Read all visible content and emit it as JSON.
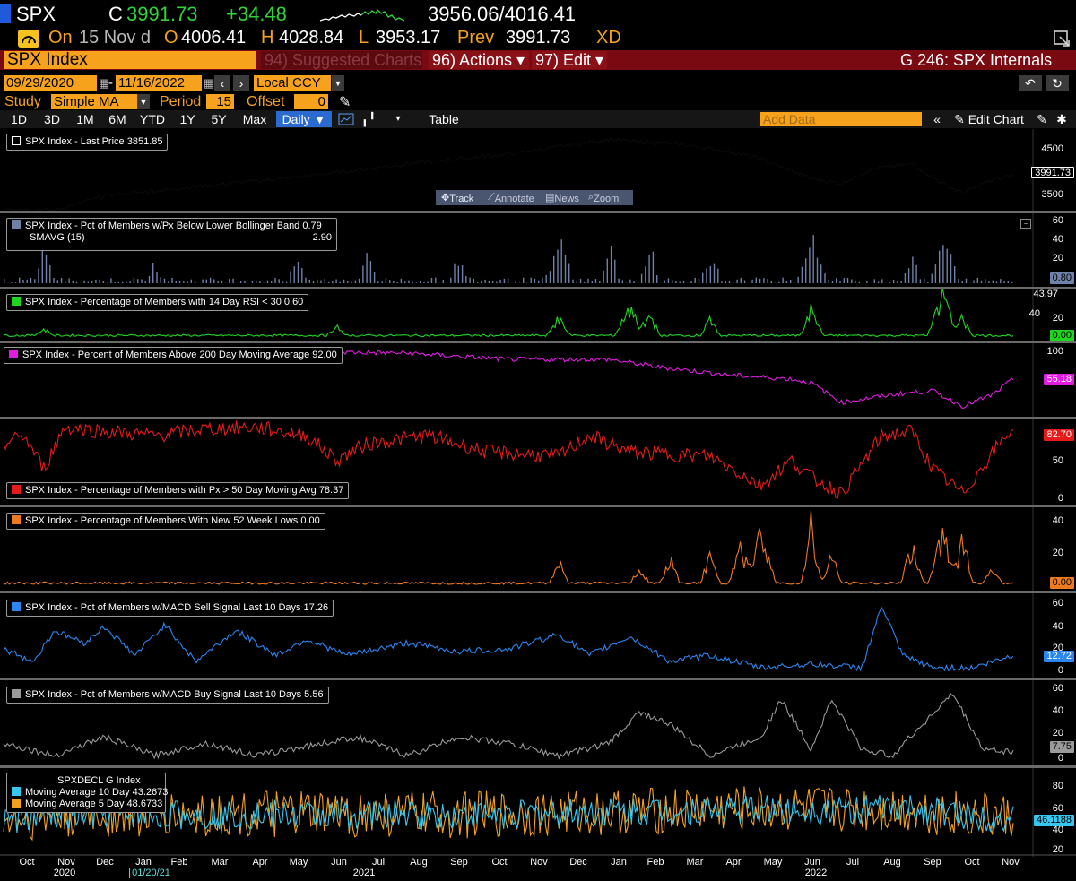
{
  "quote": {
    "ticker": "SPX",
    "c_label": "C",
    "last": "3991.73",
    "change": "+34.48",
    "range": "3956.06/4016.41",
    "on_label": "On",
    "date": "15 Nov d",
    "o_label": "O",
    "open": "4006.41",
    "h_label": "H",
    "high": "4028.84",
    "l_label": "L",
    "low": "3953.17",
    "prev_label": "Prev",
    "prev": "3991.73",
    "xd": "XD"
  },
  "titlebar": {
    "security": "SPX Index",
    "suggested": "94) Suggested Charts",
    "actions": "96) Actions ▾",
    "edit": "97) Edit ▾",
    "chart_title": "G 246: SPX Internals"
  },
  "controls": {
    "start_date": "09/29/2020",
    "end_date": "11/16/2022",
    "currency": "Local CCY",
    "study_label": "Study",
    "study_value": "Simple MA",
    "period_label": "Period",
    "period_value": "15",
    "offset_label": "Offset",
    "offset_value": "0"
  },
  "rangebar": {
    "buttons": [
      "1D",
      "3D",
      "1M",
      "6M",
      "YTD",
      "1Y",
      "5Y",
      "Max"
    ],
    "frequency": "Daily ▼",
    "table": "Table",
    "add_data_placeholder": "Add Data",
    "edit_chart": "Edit Chart"
  },
  "chart_toolbar": [
    "Track",
    "Annotate",
    "News",
    "Zoom"
  ],
  "panels": [
    {
      "legend": "SPX Index - Last Price 3851.85",
      "color": "#000000",
      "last": "3991.73",
      "ticks": [
        "4500",
        "4000",
        "3500"
      ]
    },
    {
      "legend": "SPX Index - Pct of Members w/Px Below Lower Bollinger Band 0.79",
      "legend2": "SMAVG (15)",
      "legend2_value": "2.90",
      "color": "#6f81a8",
      "last": "0.80",
      "ticks": [
        "60",
        "40",
        "20",
        "0"
      ]
    },
    {
      "legend": "SPX Index - Percentage of Members with 14 Day RSI < 30 0.60",
      "color": "#1fd61f",
      "last": "0.00",
      "top_label": "43.97",
      "ticks": [
        "40",
        "20",
        "0"
      ]
    },
    {
      "legend": "SPX Index - Percent of Members Above 200 Day Moving Average 92.00",
      "color": "#e21ce2",
      "last": "55.18",
      "ticks": [
        "100",
        "50"
      ]
    },
    {
      "legend": "SPX Index - Percentage of Members with Px > 50 Day Moving Avg 78.37",
      "color": "#e51b1b",
      "last": "82.70",
      "ticks": [
        "50",
        "0"
      ]
    },
    {
      "legend": "SPX Index - Percentage of Members With New 52 Week Lows 0.00",
      "color": "#ee7a1e",
      "last": "0.00",
      "ticks": [
        "40",
        "20",
        "0"
      ]
    },
    {
      "legend": "SPX Index - Pct of Members w/MACD Sell Signal Last 10 Days 17.26",
      "color": "#2b86f0",
      "last": "12.72",
      "ticks": [
        "60",
        "40",
        "20",
        "0"
      ]
    },
    {
      "legend": "SPX Index - Pct of Members w/MACD Buy Signal Last 10 Days 5.56",
      "color": "#9a9a9a",
      "last": "7.75",
      "ticks": [
        "60",
        "40",
        "20",
        "0"
      ]
    },
    {
      "legend": ".SPXDECL G Index",
      "legend_ma10": "Moving Average 10 Day 43.2673",
      "legend_ma5": "Moving Average 5 Day 48.6733",
      "color_ma10": "#36c6f0",
      "color_ma5": "#f4a21e",
      "last": "46.1188",
      "ticks": [
        "80",
        "60",
        "40",
        "20"
      ]
    }
  ],
  "x_axis": {
    "months": [
      "Oct",
      "Nov",
      "Dec",
      "Jan",
      "Feb",
      "Mar",
      "Apr",
      "May",
      "Jun",
      "Jul",
      "Aug",
      "Sep",
      "Oct",
      "Nov",
      "Dec",
      "Jan",
      "Feb",
      "Mar",
      "Apr",
      "May",
      "Jun",
      "Jul",
      "Aug",
      "Sep",
      "Oct",
      "Nov"
    ],
    "years": [
      "2020",
      "01/20/21",
      "2021",
      "2022"
    ]
  }
}
